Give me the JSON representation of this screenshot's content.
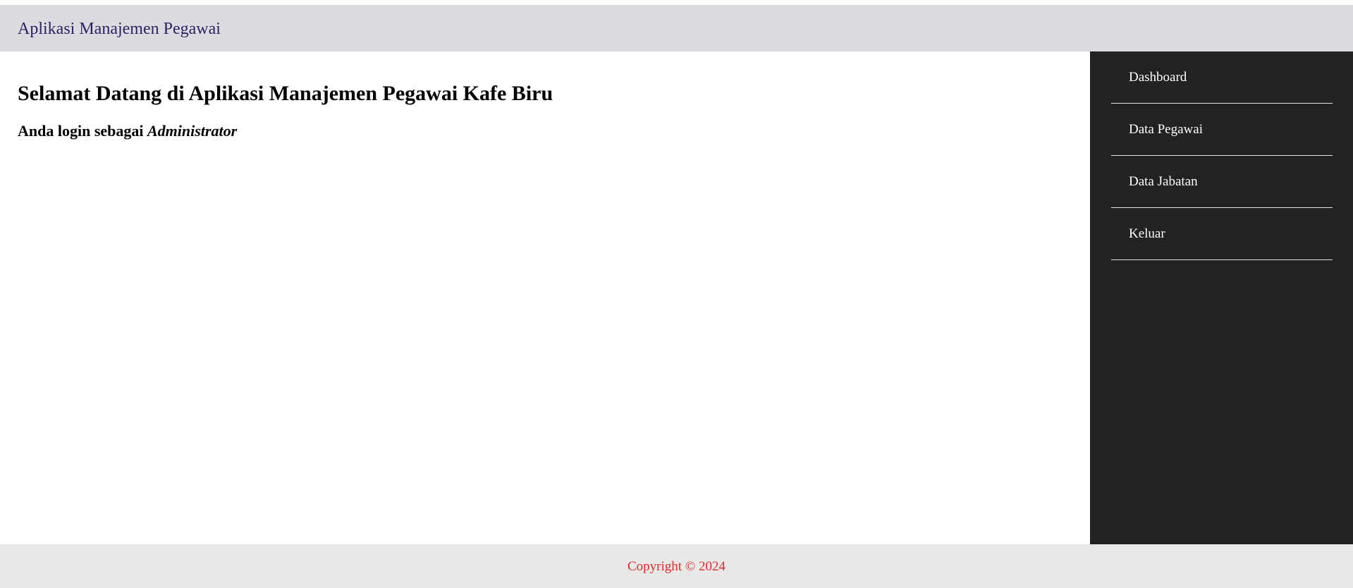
{
  "header": {
    "title": "Aplikasi Manajemen Pegawai"
  },
  "main": {
    "heading": "Selamat Datang di Aplikasi Manajemen Pegawai Kafe Biru",
    "login_prefix": "Anda login sebagai ",
    "login_role": "Administrator"
  },
  "sidebar": {
    "items": [
      {
        "label": "Dashboard"
      },
      {
        "label": "Data Pegawai"
      },
      {
        "label": "Data Jabatan"
      },
      {
        "label": "Keluar"
      }
    ]
  },
  "footer": {
    "copyright": "Copyright © 2024"
  },
  "colors": {
    "header_bg": "#dcdbe0",
    "header_text": "#2e1f63",
    "sidebar_bg": "#222222",
    "footer_bg": "#e8e8e9",
    "footer_text": "#e02b2b"
  }
}
